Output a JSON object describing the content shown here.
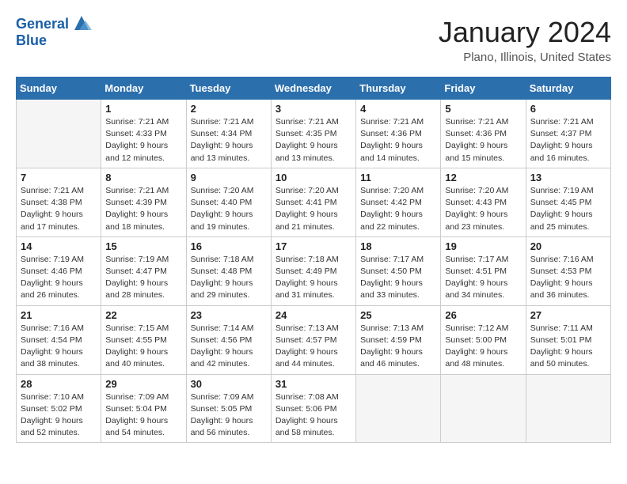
{
  "header": {
    "logo_line1": "General",
    "logo_line2": "Blue",
    "month_title": "January 2024",
    "location": "Plano, Illinois, United States"
  },
  "weekdays": [
    "Sunday",
    "Monday",
    "Tuesday",
    "Wednesday",
    "Thursday",
    "Friday",
    "Saturday"
  ],
  "weeks": [
    [
      {
        "day": "",
        "sunrise": "",
        "sunset": "",
        "daylight": ""
      },
      {
        "day": "1",
        "sunrise": "Sunrise: 7:21 AM",
        "sunset": "Sunset: 4:33 PM",
        "daylight": "Daylight: 9 hours and 12 minutes."
      },
      {
        "day": "2",
        "sunrise": "Sunrise: 7:21 AM",
        "sunset": "Sunset: 4:34 PM",
        "daylight": "Daylight: 9 hours and 13 minutes."
      },
      {
        "day": "3",
        "sunrise": "Sunrise: 7:21 AM",
        "sunset": "Sunset: 4:35 PM",
        "daylight": "Daylight: 9 hours and 13 minutes."
      },
      {
        "day": "4",
        "sunrise": "Sunrise: 7:21 AM",
        "sunset": "Sunset: 4:36 PM",
        "daylight": "Daylight: 9 hours and 14 minutes."
      },
      {
        "day": "5",
        "sunrise": "Sunrise: 7:21 AM",
        "sunset": "Sunset: 4:36 PM",
        "daylight": "Daylight: 9 hours and 15 minutes."
      },
      {
        "day": "6",
        "sunrise": "Sunrise: 7:21 AM",
        "sunset": "Sunset: 4:37 PM",
        "daylight": "Daylight: 9 hours and 16 minutes."
      }
    ],
    [
      {
        "day": "7",
        "sunrise": "Sunrise: 7:21 AM",
        "sunset": "Sunset: 4:38 PM",
        "daylight": "Daylight: 9 hours and 17 minutes."
      },
      {
        "day": "8",
        "sunrise": "Sunrise: 7:21 AM",
        "sunset": "Sunset: 4:39 PM",
        "daylight": "Daylight: 9 hours and 18 minutes."
      },
      {
        "day": "9",
        "sunrise": "Sunrise: 7:20 AM",
        "sunset": "Sunset: 4:40 PM",
        "daylight": "Daylight: 9 hours and 19 minutes."
      },
      {
        "day": "10",
        "sunrise": "Sunrise: 7:20 AM",
        "sunset": "Sunset: 4:41 PM",
        "daylight": "Daylight: 9 hours and 21 minutes."
      },
      {
        "day": "11",
        "sunrise": "Sunrise: 7:20 AM",
        "sunset": "Sunset: 4:42 PM",
        "daylight": "Daylight: 9 hours and 22 minutes."
      },
      {
        "day": "12",
        "sunrise": "Sunrise: 7:20 AM",
        "sunset": "Sunset: 4:43 PM",
        "daylight": "Daylight: 9 hours and 23 minutes."
      },
      {
        "day": "13",
        "sunrise": "Sunrise: 7:19 AM",
        "sunset": "Sunset: 4:45 PM",
        "daylight": "Daylight: 9 hours and 25 minutes."
      }
    ],
    [
      {
        "day": "14",
        "sunrise": "Sunrise: 7:19 AM",
        "sunset": "Sunset: 4:46 PM",
        "daylight": "Daylight: 9 hours and 26 minutes."
      },
      {
        "day": "15",
        "sunrise": "Sunrise: 7:19 AM",
        "sunset": "Sunset: 4:47 PM",
        "daylight": "Daylight: 9 hours and 28 minutes."
      },
      {
        "day": "16",
        "sunrise": "Sunrise: 7:18 AM",
        "sunset": "Sunset: 4:48 PM",
        "daylight": "Daylight: 9 hours and 29 minutes."
      },
      {
        "day": "17",
        "sunrise": "Sunrise: 7:18 AM",
        "sunset": "Sunset: 4:49 PM",
        "daylight": "Daylight: 9 hours and 31 minutes."
      },
      {
        "day": "18",
        "sunrise": "Sunrise: 7:17 AM",
        "sunset": "Sunset: 4:50 PM",
        "daylight": "Daylight: 9 hours and 33 minutes."
      },
      {
        "day": "19",
        "sunrise": "Sunrise: 7:17 AM",
        "sunset": "Sunset: 4:51 PM",
        "daylight": "Daylight: 9 hours and 34 minutes."
      },
      {
        "day": "20",
        "sunrise": "Sunrise: 7:16 AM",
        "sunset": "Sunset: 4:53 PM",
        "daylight": "Daylight: 9 hours and 36 minutes."
      }
    ],
    [
      {
        "day": "21",
        "sunrise": "Sunrise: 7:16 AM",
        "sunset": "Sunset: 4:54 PM",
        "daylight": "Daylight: 9 hours and 38 minutes."
      },
      {
        "day": "22",
        "sunrise": "Sunrise: 7:15 AM",
        "sunset": "Sunset: 4:55 PM",
        "daylight": "Daylight: 9 hours and 40 minutes."
      },
      {
        "day": "23",
        "sunrise": "Sunrise: 7:14 AM",
        "sunset": "Sunset: 4:56 PM",
        "daylight": "Daylight: 9 hours and 42 minutes."
      },
      {
        "day": "24",
        "sunrise": "Sunrise: 7:13 AM",
        "sunset": "Sunset: 4:57 PM",
        "daylight": "Daylight: 9 hours and 44 minutes."
      },
      {
        "day": "25",
        "sunrise": "Sunrise: 7:13 AM",
        "sunset": "Sunset: 4:59 PM",
        "daylight": "Daylight: 9 hours and 46 minutes."
      },
      {
        "day": "26",
        "sunrise": "Sunrise: 7:12 AM",
        "sunset": "Sunset: 5:00 PM",
        "daylight": "Daylight: 9 hours and 48 minutes."
      },
      {
        "day": "27",
        "sunrise": "Sunrise: 7:11 AM",
        "sunset": "Sunset: 5:01 PM",
        "daylight": "Daylight: 9 hours and 50 minutes."
      }
    ],
    [
      {
        "day": "28",
        "sunrise": "Sunrise: 7:10 AM",
        "sunset": "Sunset: 5:02 PM",
        "daylight": "Daylight: 9 hours and 52 minutes."
      },
      {
        "day": "29",
        "sunrise": "Sunrise: 7:09 AM",
        "sunset": "Sunset: 5:04 PM",
        "daylight": "Daylight: 9 hours and 54 minutes."
      },
      {
        "day": "30",
        "sunrise": "Sunrise: 7:09 AM",
        "sunset": "Sunset: 5:05 PM",
        "daylight": "Daylight: 9 hours and 56 minutes."
      },
      {
        "day": "31",
        "sunrise": "Sunrise: 7:08 AM",
        "sunset": "Sunset: 5:06 PM",
        "daylight": "Daylight: 9 hours and 58 minutes."
      },
      {
        "day": "",
        "sunrise": "",
        "sunset": "",
        "daylight": ""
      },
      {
        "day": "",
        "sunrise": "",
        "sunset": "",
        "daylight": ""
      },
      {
        "day": "",
        "sunrise": "",
        "sunset": "",
        "daylight": ""
      }
    ]
  ]
}
